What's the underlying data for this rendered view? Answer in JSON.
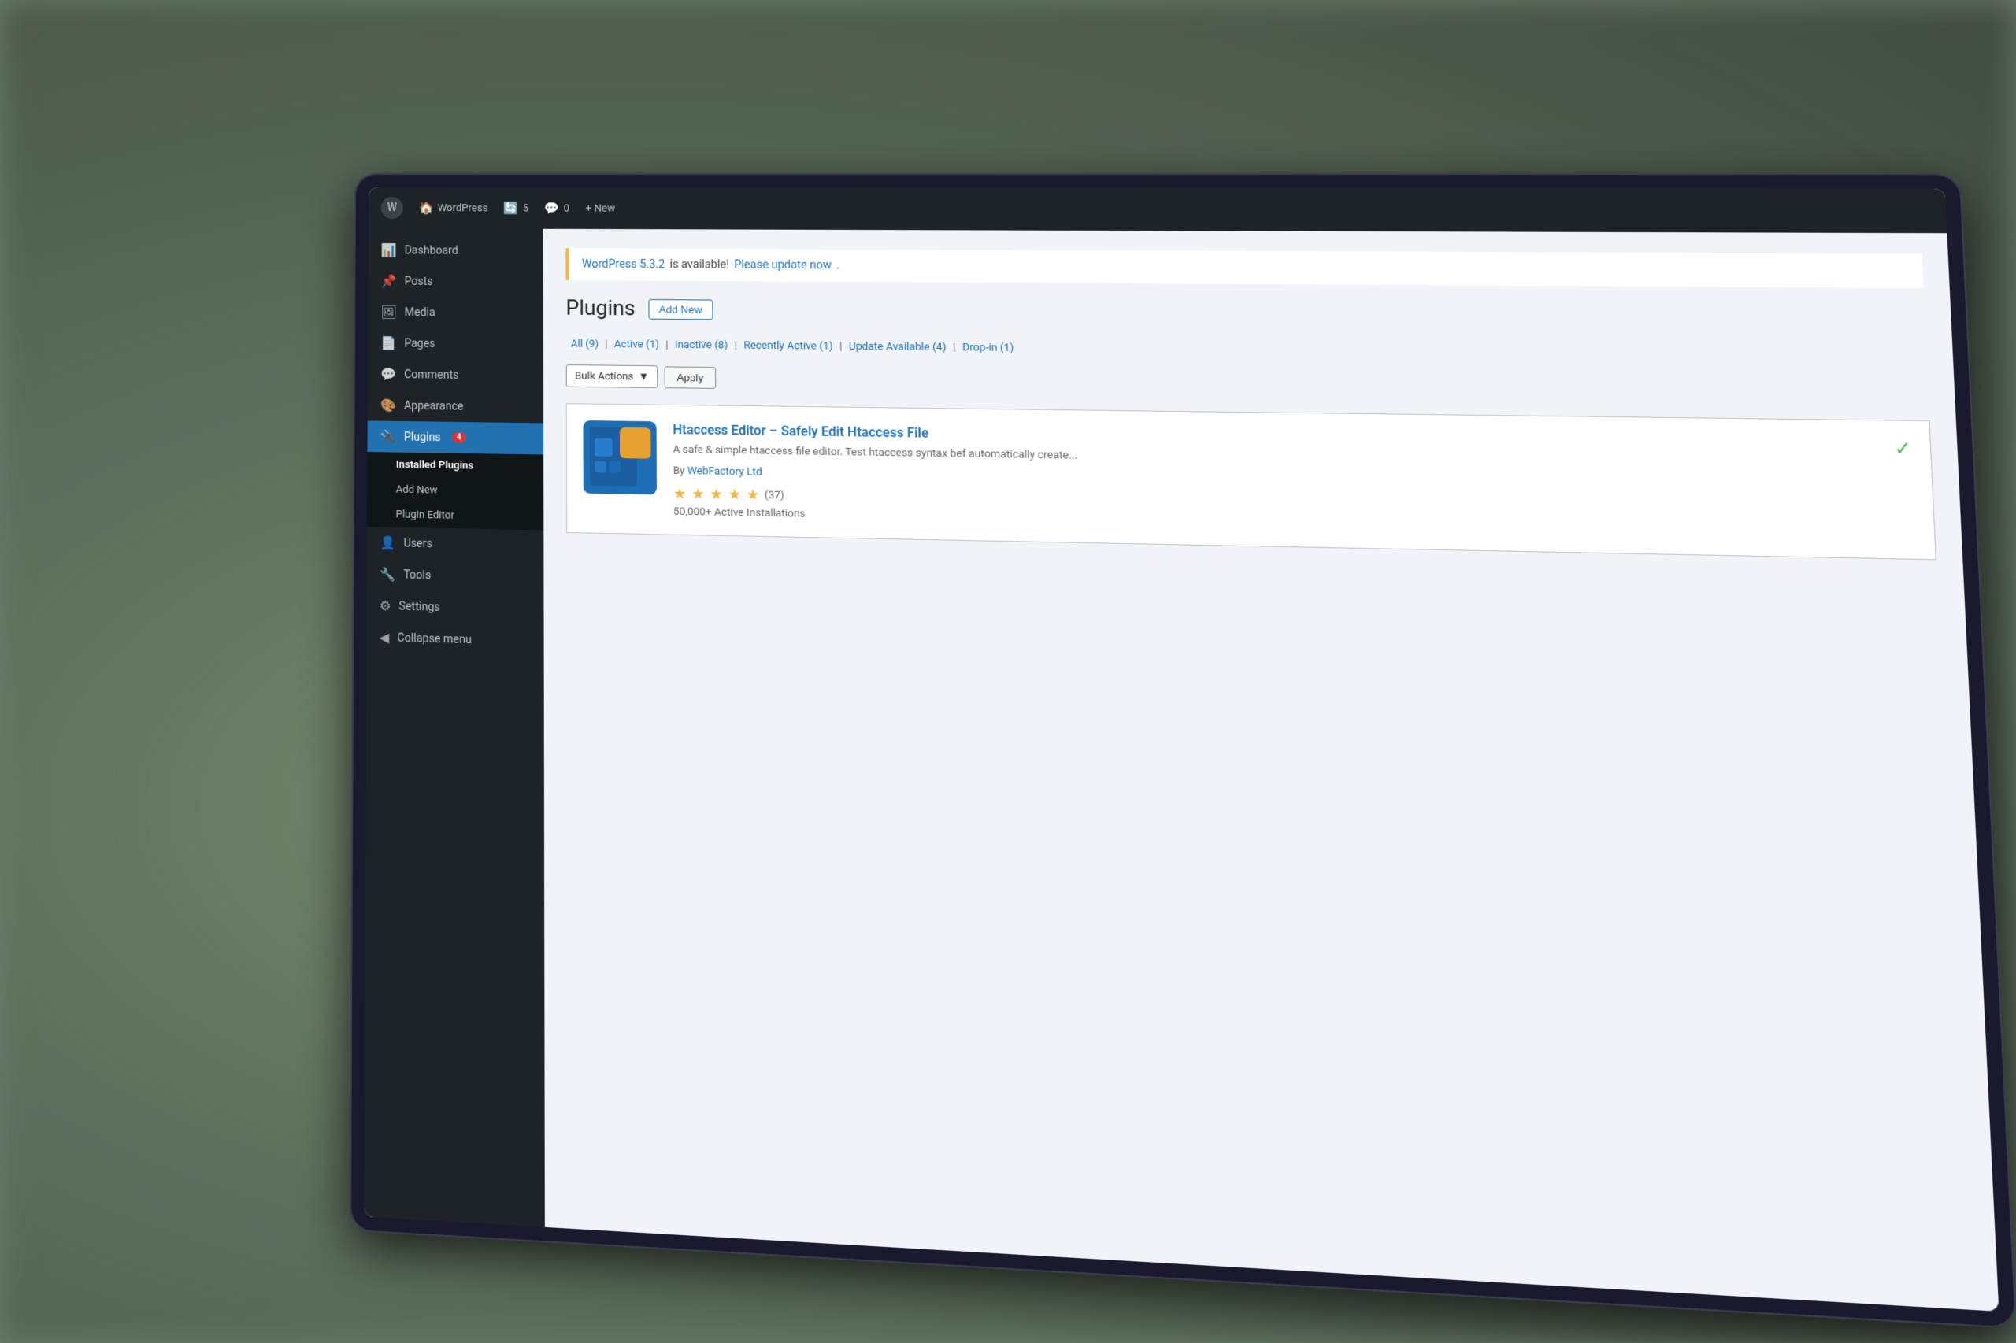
{
  "background": {
    "color": "#5a6b5a"
  },
  "adminBar": {
    "logo": "W",
    "items": [
      {
        "label": "WordPress",
        "icon": "🏠"
      },
      {
        "label": "5",
        "icon": "🔄"
      },
      {
        "label": "0",
        "icon": "💬"
      },
      {
        "label": "+ New",
        "icon": ""
      }
    ]
  },
  "sidebar": {
    "items": [
      {
        "label": "Dashboard",
        "icon": "📊",
        "active": false
      },
      {
        "label": "Posts",
        "icon": "📌",
        "active": false
      },
      {
        "label": "Media",
        "icon": "🖼",
        "active": false
      },
      {
        "label": "Pages",
        "icon": "📄",
        "active": false
      },
      {
        "label": "Comments",
        "icon": "💬",
        "active": false
      },
      {
        "label": "Appearance",
        "icon": "🎨",
        "active": false
      },
      {
        "label": "Plugins",
        "icon": "🔌",
        "badge": "4",
        "active": true
      },
      {
        "label": "Users",
        "icon": "👤",
        "active": false
      },
      {
        "label": "Tools",
        "icon": "🔧",
        "active": false
      },
      {
        "label": "Settings",
        "icon": "⚙",
        "active": false
      },
      {
        "label": "Collapse menu",
        "icon": "◀",
        "active": false
      }
    ],
    "pluginsSubmenu": [
      {
        "label": "Installed Plugins",
        "active": true
      },
      {
        "label": "Add New",
        "active": false
      },
      {
        "label": "Plugin Editor",
        "active": false
      }
    ]
  },
  "updateNotice": {
    "text1": "WordPress 5.3.2",
    "text2": " is available! ",
    "linkText": "Please update now",
    "linkSuffix": "."
  },
  "pageTitle": "Plugins",
  "addNewButton": "Add New",
  "filterTabs": [
    {
      "label": "All",
      "count": "(9)",
      "sep": " | "
    },
    {
      "label": "Active",
      "count": "(1)",
      "sep": " | "
    },
    {
      "label": "Inactive",
      "count": "(8)",
      "sep": " | "
    },
    {
      "label": "Recently Active",
      "count": "(1)",
      "sep": " | "
    },
    {
      "label": "Update Available",
      "count": "(4)",
      "sep": " | "
    },
    {
      "label": "Drop-in",
      "count": "(1)",
      "sep": ""
    }
  ],
  "bulkActions": {
    "selectLabel": "Bulk Actions",
    "applyLabel": "Apply"
  },
  "plugin": {
    "name": "Htaccess Editor – Safely Edit Htaccess File",
    "description": "A safe & simple htaccess file editor. Test htaccess syntax bef automatically create...",
    "author": "By WebFactory Ltd",
    "authorLink": "WebFactory Ltd",
    "stars": 5,
    "reviewCount": "(37)",
    "installs": "50,000+ Active Installations",
    "compatible": true
  }
}
